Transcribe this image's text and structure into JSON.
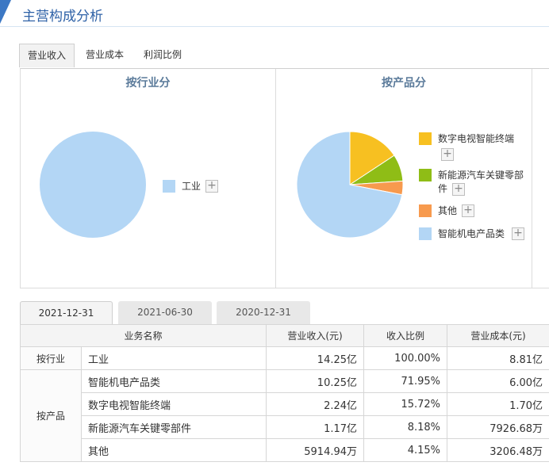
{
  "page": {
    "title": "主营构成分析"
  },
  "tabs": [
    {
      "label": "营业收入",
      "active": true
    },
    {
      "label": "营业成本",
      "active": false
    },
    {
      "label": "利润比例",
      "active": false
    }
  ],
  "industry_chart": {
    "title": "按行业分",
    "legend": [
      {
        "label": "工业",
        "color": "#b3d6f5"
      }
    ]
  },
  "product_chart": {
    "title": "按产品分",
    "legend": [
      {
        "label": "数字电视智能终端",
        "color": "#f7c021"
      },
      {
        "label_line1": "新能源汽车关键零部",
        "label_line2": "件",
        "color": "#8fbd16"
      },
      {
        "label": "其他",
        "color": "#f79a4e"
      },
      {
        "label": "智能机电产品类",
        "color": "#b3d6f5"
      }
    ]
  },
  "chart_data": [
    {
      "type": "pie",
      "title": "按行业分",
      "categories": [
        "工业"
      ],
      "values": [
        100.0
      ],
      "colors": [
        "#b3d6f5"
      ]
    },
    {
      "type": "pie",
      "title": "按产品分",
      "categories": [
        "数字电视智能终端",
        "新能源汽车关键零部件",
        "其他",
        "智能机电产品类"
      ],
      "values": [
        15.72,
        8.18,
        4.15,
        71.95
      ],
      "colors": [
        "#f7c021",
        "#8fbd16",
        "#f79a4e",
        "#b3d6f5"
      ]
    }
  ],
  "date_tabs": [
    {
      "label": "2021-12-31",
      "active": true
    },
    {
      "label": "2021-06-30",
      "active": false
    },
    {
      "label": "2020-12-31",
      "active": false
    }
  ],
  "table": {
    "headers": [
      "业务名称",
      "营业收入(元)",
      "收入比例",
      "营业成本(元)"
    ],
    "groups": [
      {
        "group": "按行业",
        "rows": [
          {
            "name": "工业",
            "revenue": "14.25亿",
            "ratio": "100.00%",
            "cost": "8.81亿"
          }
        ]
      },
      {
        "group": "按产品",
        "rows": [
          {
            "name": "智能机电产品类",
            "revenue": "10.25亿",
            "ratio": "71.95%",
            "cost": "6.00亿"
          },
          {
            "name": "数字电视智能终端",
            "revenue": "2.24亿",
            "ratio": "15.72%",
            "cost": "1.70亿"
          },
          {
            "name": "新能源汽车关键零部件",
            "revenue": "1.17亿",
            "ratio": "8.18%",
            "cost": "7926.68万"
          },
          {
            "name": "其他",
            "revenue": "5914.94万",
            "ratio": "4.15%",
            "cost": "3206.48万"
          }
        ]
      }
    ]
  }
}
